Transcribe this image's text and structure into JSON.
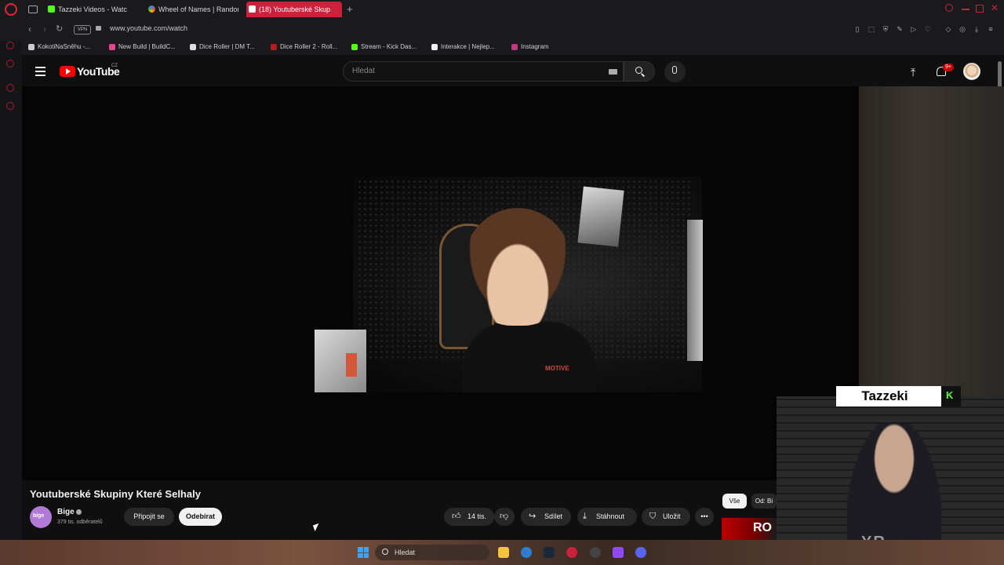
{
  "browser": {
    "tabs": [
      {
        "label": "Tazzeki Videos - Watc",
        "color": "#53fc18"
      },
      {
        "label": "Wheel of Names | Random",
        "color": "#4285f4"
      },
      {
        "label": "(18) Youtuberské Skup",
        "color": "#ff0000",
        "active": true
      }
    ],
    "url": "www.youtube.com/watch",
    "vpn_label": "VPN",
    "bookmarks": [
      {
        "label": "KokotiNaSněhu -...",
        "color": "#cccccc"
      },
      {
        "label": "New Build | BuildC...",
        "color": "#e84393"
      },
      {
        "label": "Dice Roller | DM T...",
        "color": "#dddddd"
      },
      {
        "label": "Dice Roller 2 - Roll...",
        "color": "#b71c1c"
      },
      {
        "label": "Stream - Kick Das...",
        "color": "#53fc18"
      },
      {
        "label": "Interakce | Nejlep...",
        "color": "#eeeeee"
      },
      {
        "label": "Instagram",
        "color": "#c13584"
      }
    ]
  },
  "youtube": {
    "logo_text": "YouTube",
    "country": "CZ",
    "search_placeholder": "Hledat",
    "notification_count": "9+"
  },
  "video": {
    "title": "Youtuberské Skupiny Které Selhaly",
    "shirt_print": "MOTIVE"
  },
  "channel": {
    "avatar_text": "bige",
    "name": "Bige",
    "subscribers": "379 tis. odběratelů",
    "join_label": "Připojit se",
    "subscribe_label": "Odebírat"
  },
  "actions": {
    "likes": "14 tis.",
    "share": "Sdílet",
    "download": "Stáhnout",
    "save": "Uložit"
  },
  "chips": {
    "all": "Vše",
    "from": "Od: Bi"
  },
  "promo_text": "RO",
  "overlay": {
    "streamer_name": "Tazzeki",
    "kick_letter": "K"
  },
  "taskbar": {
    "search_text": "Hledat"
  }
}
